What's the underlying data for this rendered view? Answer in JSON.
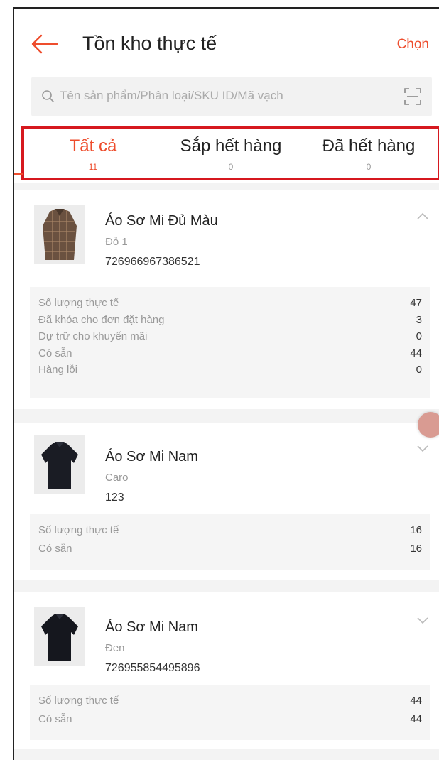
{
  "header": {
    "title": "Tồn kho thực tế",
    "right_action": "Chọn"
  },
  "search": {
    "placeholder": "Tên sản phẩm/Phân loại/SKU ID/Mã vạch"
  },
  "tabs": [
    {
      "label": "Tất cả",
      "count": "11",
      "active": true
    },
    {
      "label": "Sắp hết hàng",
      "count": "0",
      "active": false
    },
    {
      "label": "Đã hết hàng",
      "count": "0",
      "active": false
    }
  ],
  "products": [
    {
      "name": "Áo Sơ Mi Đủ Màu",
      "variant": "Đỏ 1",
      "sku": "726966967386521",
      "expanded": true,
      "stats": [
        {
          "label": "Số lượng thực tế",
          "value": "47"
        },
        {
          "label": "Đã khóa cho đơn đặt hàng",
          "value": "3"
        },
        {
          "label": "Dự trữ cho khuyến mãi",
          "value": "0"
        },
        {
          "label": "Có sẵn",
          "value": "44"
        },
        {
          "label": "Hàng lỗi",
          "value": "0"
        }
      ]
    },
    {
      "name": "Áo Sơ Mi Nam",
      "variant": "Caro",
      "sku": "123",
      "expanded": false,
      "stats": [
        {
          "label": "Số lượng thực tế",
          "value": "16"
        },
        {
          "label": "Có sẵn",
          "value": "16"
        }
      ]
    },
    {
      "name": "Áo Sơ Mi Nam",
      "variant": "Đen",
      "sku": "726955854495896",
      "expanded": false,
      "stats": [
        {
          "label": "Số lượng thực tế",
          "value": "44"
        },
        {
          "label": "Có sẵn",
          "value": "44"
        }
      ]
    }
  ],
  "colors": {
    "accent": "#ee4d2d",
    "highlight_border": "#d6181f"
  }
}
